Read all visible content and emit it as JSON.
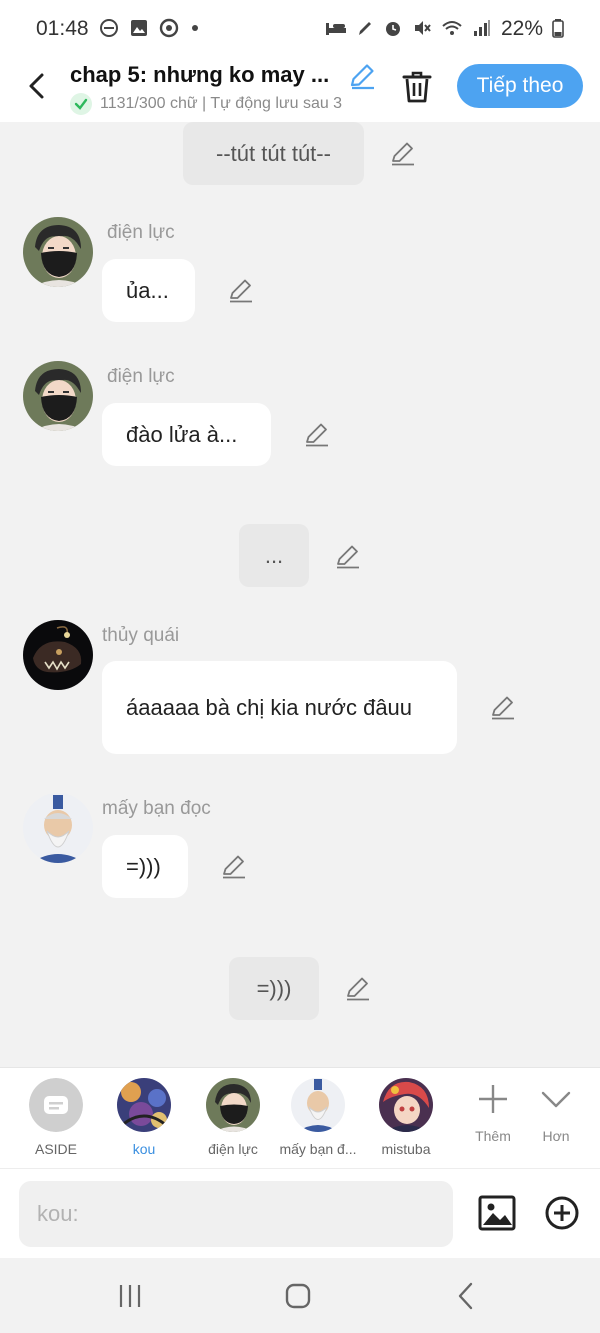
{
  "status_bar": {
    "time": "01:48",
    "battery": "22%",
    "icons": [
      "do-not-disturb-icon",
      "gallery-icon",
      "chrome-icon",
      "dot-icon",
      "sleep-icon",
      "pen-icon",
      "alarm-icon",
      "mute-icon",
      "wifi-icon",
      "signal-icon",
      "battery-icon"
    ]
  },
  "header": {
    "title": "chap 5: nhưng ko may ...",
    "subtitle": "1131/300 chữ | Tự động lưu sau 3",
    "next_label": "Tiếp theo"
  },
  "messages": [
    {
      "type": "narration",
      "text": "--tút tút tút--"
    },
    {
      "type": "dialog",
      "speaker": "điện lực",
      "text": "ủa...",
      "avatar": "masked-man-avatar"
    },
    {
      "type": "dialog",
      "speaker": "điện lực",
      "text": "đào lửa à...",
      "avatar": "masked-man-avatar"
    },
    {
      "type": "narration",
      "text": "..."
    },
    {
      "type": "dialog",
      "speaker": "thủy quái",
      "text": "áaaaaa bà chị kia nước đâuu",
      "avatar": "anglerfish-avatar"
    },
    {
      "type": "dialog",
      "speaker": "mấy bạn đọc",
      "text": "=)))",
      "avatar": "old-man-avatar"
    },
    {
      "type": "narration",
      "text": "=)))"
    }
  ],
  "characters": [
    {
      "label": "ASIDE",
      "icon": "aside-icon",
      "active": false
    },
    {
      "label": "kou",
      "icon": "kou-avatar",
      "active": true
    },
    {
      "label": "điện lực",
      "icon": "masked-man-avatar",
      "active": false
    },
    {
      "label": "mấy bạn đ...",
      "icon": "old-man-avatar",
      "active": false
    },
    {
      "label": "mistuba",
      "icon": "mistuba-avatar",
      "active": false
    }
  ],
  "tools": {
    "add_label": "Thêm",
    "more_label": "Hơn"
  },
  "composer": {
    "placeholder": "kou:",
    "value": ""
  },
  "colors": {
    "accent": "#4da3f1",
    "active_character": "#3b8fe0",
    "background": "#f2f2f2"
  }
}
